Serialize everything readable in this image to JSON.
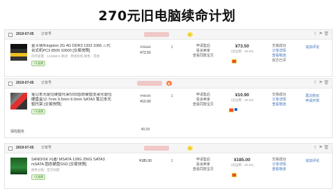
{
  "title": "270元旧电脑续命计划",
  "orders": [
    {
      "date": "2019-07-05",
      "order_no": "订单号",
      "item_name": "金士顿/Kingston 2G 4G DDR3 1333 1066 三代台式机PC3 8500 10600 [交易快照]",
      "item_sub": "内存容量：1333MHz 款式：原装拆机 颜色：其他",
      "badge": "7天退换",
      "price_original": "¥73.50",
      "price_current": "¥73.50",
      "qty": "1",
      "service": [
        "申请售后",
        "投诉卖家",
        "查看同款宝贝"
      ],
      "total": "¥73.50",
      "total_sub": "(含运费：¥0.00)",
      "total_sub2": "手机订单",
      "status": [
        "交易成功",
        "订单详情",
        "查看物流",
        "双方已评"
      ],
      "action": "追加评论"
    },
    {
      "date": "2019-07-05",
      "order_no": "订单号",
      "item_name": "笔记本光驱位硬盘托架SSD固态硬盘支架光驱位硬盘盒12.7mm 9.5mm 9.0mm SATA3 笔记本光驱托架 [交易快照]",
      "item_sub": "",
      "badge": "7天退换",
      "price_original": "¥45.00",
      "price_current": "¥10.90",
      "qty": "1",
      "service": [
        "申请售后",
        "投诉卖家",
        "查看同款宝贝"
      ],
      "total": "¥10.90",
      "total_sub": "(含运费：¥0.00)",
      "total_sub2": "手机订单",
      "status": [
        "交易成功",
        "订单详情",
        "查看物流"
      ],
      "action": [
        "再次购买",
        "申请开票"
      ],
      "gift_label": "保险服务",
      "gift_price": "¥0.00"
    },
    {
      "date": "2019-07-05",
      "order_no": "订单号",
      "item_name": "SANDISK 闪迪/ MSATA 128G 256G SATA3 mSATA 固态硬盘SSD [交易快照]",
      "item_sub": "颜色分类：官方标配",
      "badge": "7天退换",
      "price_original": "",
      "price_current": "¥185.00",
      "qty": "1",
      "service": [
        "申请售后",
        "投诉卖家",
        "查看同款宝贝"
      ],
      "total": "¥185.00",
      "total_sub": "(含运费：¥0.00)",
      "total_sub2": "手机订单",
      "status": [
        "交易成功",
        "订单详情",
        "查看物流"
      ],
      "action": "追加评论"
    }
  ],
  "head_icons": [
    "share-icon",
    "flag-icon",
    "delete-icon"
  ]
}
